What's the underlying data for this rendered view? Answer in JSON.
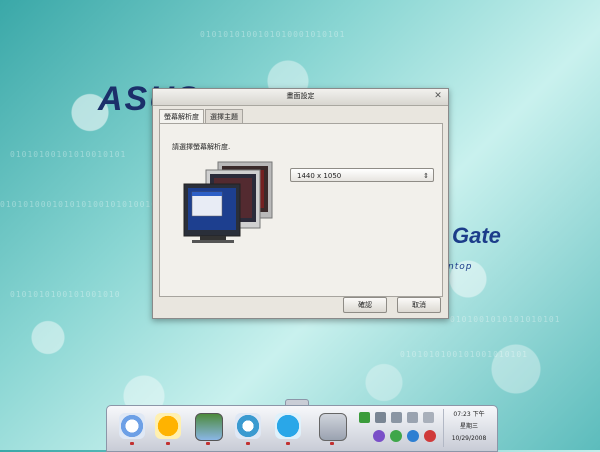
{
  "desktop": {
    "brand_logo": "ASUS",
    "gate_text": "Gate",
    "tagline": "ntop"
  },
  "dialog": {
    "title": "畫面設定",
    "tabs": [
      {
        "label": "螢幕解析度",
        "active": true
      },
      {
        "label": "選擇主題",
        "active": false
      }
    ],
    "prompt": "請選擇螢幕解析度.",
    "resolution_value": "1440 x 1050",
    "ok_label": "確認",
    "cancel_label": "取消"
  },
  "taskbar": {
    "apps": [
      {
        "icon": "compass-icon"
      },
      {
        "icon": "game-icon"
      },
      {
        "icon": "photo-icon"
      },
      {
        "icon": "chat-icon"
      },
      {
        "icon": "skype-icon"
      },
      {
        "icon": "settings-icon"
      }
    ],
    "clock": {
      "time": "07:23 下午",
      "weekday": "星期三",
      "date": "10/29/2008"
    }
  }
}
